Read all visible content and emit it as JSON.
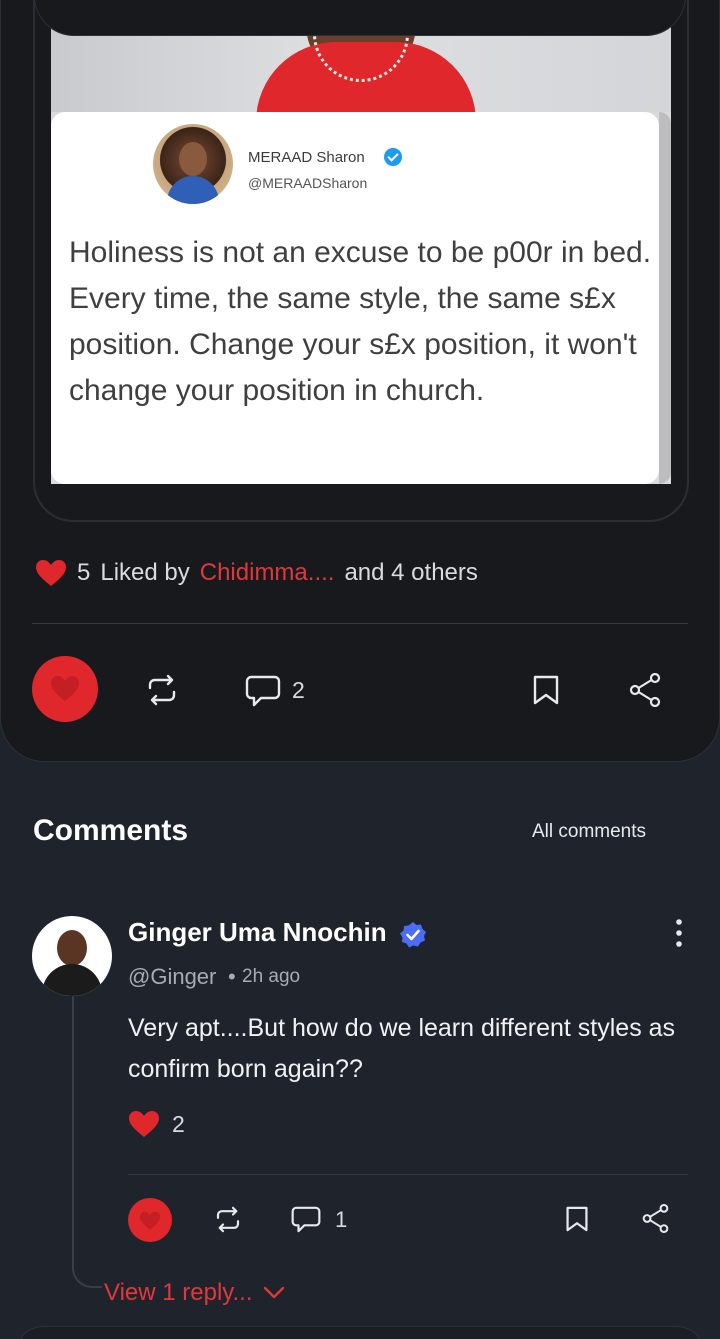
{
  "post": {
    "tweet": {
      "author_name": "MERAAD Sharon",
      "author_handle": "@MERAADSharon",
      "text": "Holiness is not an excuse to be p00r in bed. Every time, the same style, the same s£x position. Change your s£x position, it won't change your position in church."
    },
    "likes": {
      "count": "5",
      "liked_by_prefix": "Liked by",
      "liked_by_name": "Chidimma....",
      "liked_by_suffix": "and 4 others"
    },
    "actions": {
      "comment_count": "2"
    }
  },
  "comments_section": {
    "title": "Comments",
    "filter_label": "All comments"
  },
  "comment": {
    "name": "Ginger Uma Nnochin",
    "handle": "@Ginger",
    "separator": "•",
    "time": "2h ago",
    "text": "Very apt....But how do we learn different styles as confirm  born again??",
    "like_count": "2",
    "reply_count": "1",
    "view_replies_label": "View 1 reply..."
  },
  "colors": {
    "accent_red": "#e0272c",
    "background": "#1f232b",
    "card": "#17191d",
    "verified_blue": "#4a6cf7"
  },
  "icons": [
    "heart-icon",
    "repost-icon",
    "comment-icon",
    "bookmark-icon",
    "share-icon",
    "more-vertical-icon",
    "verified-icon",
    "chevron-down-icon"
  ]
}
